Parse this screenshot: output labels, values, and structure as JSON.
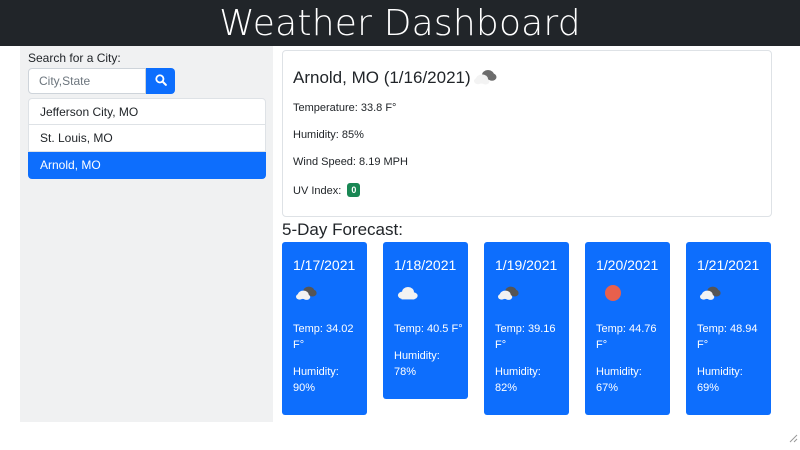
{
  "header": {
    "title": "Weather Dashboard"
  },
  "sidebar": {
    "search_label": "Search for a City:",
    "search_placeholder": "City,State",
    "search_value": "",
    "cities": [
      "Jefferson City, MO",
      "St. Louis, MO",
      "Arnold, MO"
    ],
    "active_city": "Arnold, MO"
  },
  "current": {
    "title": "Arnold, MO (1/16/2021)",
    "icon": "broken-clouds-icon",
    "temperature": "Temperature: 33.8 F°",
    "humidity": "Humidity: 85%",
    "wind": "Wind Speed: 8.19 MPH",
    "uv_label": "UV Index:",
    "uv_value": "0",
    "uv_color": "#198754"
  },
  "forecast": {
    "heading": "5-Day Forecast:",
    "days": [
      {
        "date": "1/17/2021",
        "icon": "broken-clouds-icon",
        "temp": "Temp: 34.02 F°",
        "humidity": "Humidity: 90%"
      },
      {
        "date": "1/18/2021",
        "icon": "cloud-icon",
        "temp": "Temp: 40.5 F°",
        "humidity": "Humidity: 78%"
      },
      {
        "date": "1/19/2021",
        "icon": "broken-clouds-icon",
        "temp": "Temp: 39.16 F°",
        "humidity": "Humidity: 82%"
      },
      {
        "date": "1/20/2021",
        "icon": "sun-icon",
        "temp": "Temp: 44.76 F°",
        "humidity": "Humidity: 67%"
      },
      {
        "date": "1/21/2021",
        "icon": "broken-clouds-icon",
        "temp": "Temp: 48.94 F°",
        "humidity": "Humidity: 69%"
      }
    ]
  },
  "colors": {
    "accent": "#0d6efd",
    "header_bg": "#212529",
    "sun": "#e8604c"
  }
}
